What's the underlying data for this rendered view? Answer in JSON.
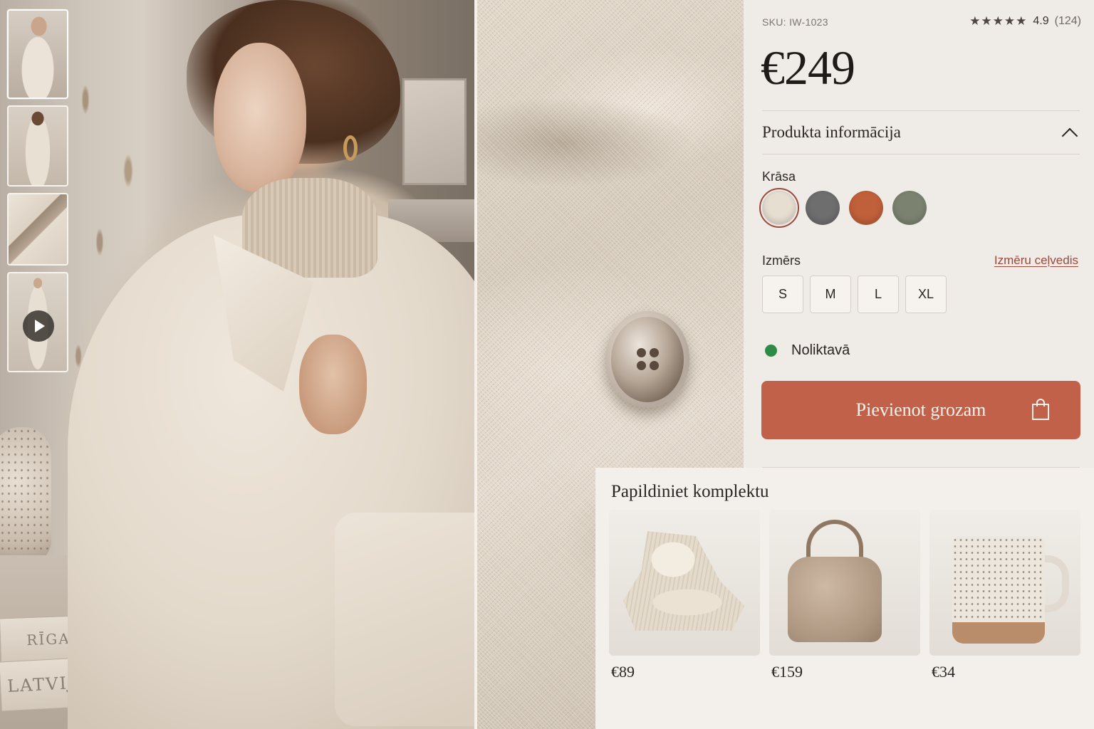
{
  "product": {
    "sku": "SKU: IW-1023",
    "rating_stars": "★★★★★",
    "rating_value": "4.9",
    "rating_count": "(124)",
    "price": "€249"
  },
  "info": {
    "label": "Produkta informācija"
  },
  "color": {
    "label": "Krāsa",
    "swatches": [
      {
        "name": "cream",
        "hex": "#e7ded2"
      },
      {
        "name": "grey",
        "hex": "#6e6e6e"
      },
      {
        "name": "rust",
        "hex": "#c0603a"
      },
      {
        "name": "olive",
        "hex": "#7b8370"
      }
    ],
    "selected": "cream"
  },
  "size": {
    "label": "Izmērs",
    "guide_link": "Izmēru ceļvedis",
    "options": [
      "S",
      "M",
      "L",
      "XL"
    ]
  },
  "stock": {
    "text": "Noliktavā",
    "color": "#2e8b45"
  },
  "cart": {
    "label": "Pievienot grozam",
    "accent": "#c1614a"
  },
  "upsell": {
    "title": "Papildiniet komplektu",
    "items": [
      {
        "icon": "scarf-image",
        "price": "€89"
      },
      {
        "icon": "handbag-image",
        "price": "€159"
      },
      {
        "icon": "mug-image",
        "price": "€34"
      }
    ]
  },
  "gallery": {
    "books": [
      "RĪGA",
      "LATVIJA"
    ],
    "thumbnails": [
      "coat-front",
      "coat-back",
      "coat-collar-detail",
      "coat-video"
    ]
  }
}
